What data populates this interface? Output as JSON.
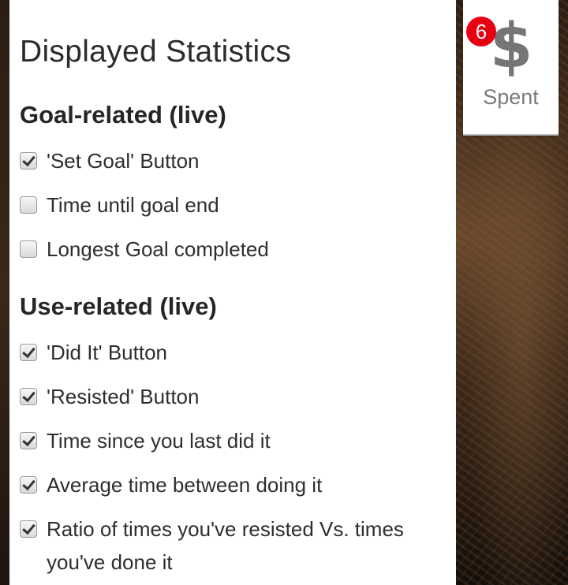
{
  "panel": {
    "title": "Displayed Statistics",
    "sections": [
      {
        "heading": "Goal-related (live)",
        "options": [
          {
            "label": "'Set Goal' Button",
            "checked": true
          },
          {
            "label": "Time until goal end",
            "checked": false
          },
          {
            "label": "Longest Goal completed",
            "checked": false
          }
        ]
      },
      {
        "heading": "Use-related (live)",
        "options": [
          {
            "label": "'Did It' Button",
            "checked": true
          },
          {
            "label": "'Resisted' Button",
            "checked": true
          },
          {
            "label": "Time since you last did it",
            "checked": true
          },
          {
            "label": "Average time between doing it",
            "checked": true
          },
          {
            "label": "Ratio of times you've resisted Vs. times you've done it",
            "checked": true
          }
        ]
      }
    ]
  },
  "widget": {
    "icon": "dollar-icon",
    "icon_glyph": "$",
    "badge_count": "6",
    "label": "Spent",
    "badge_color": "#e60012"
  }
}
